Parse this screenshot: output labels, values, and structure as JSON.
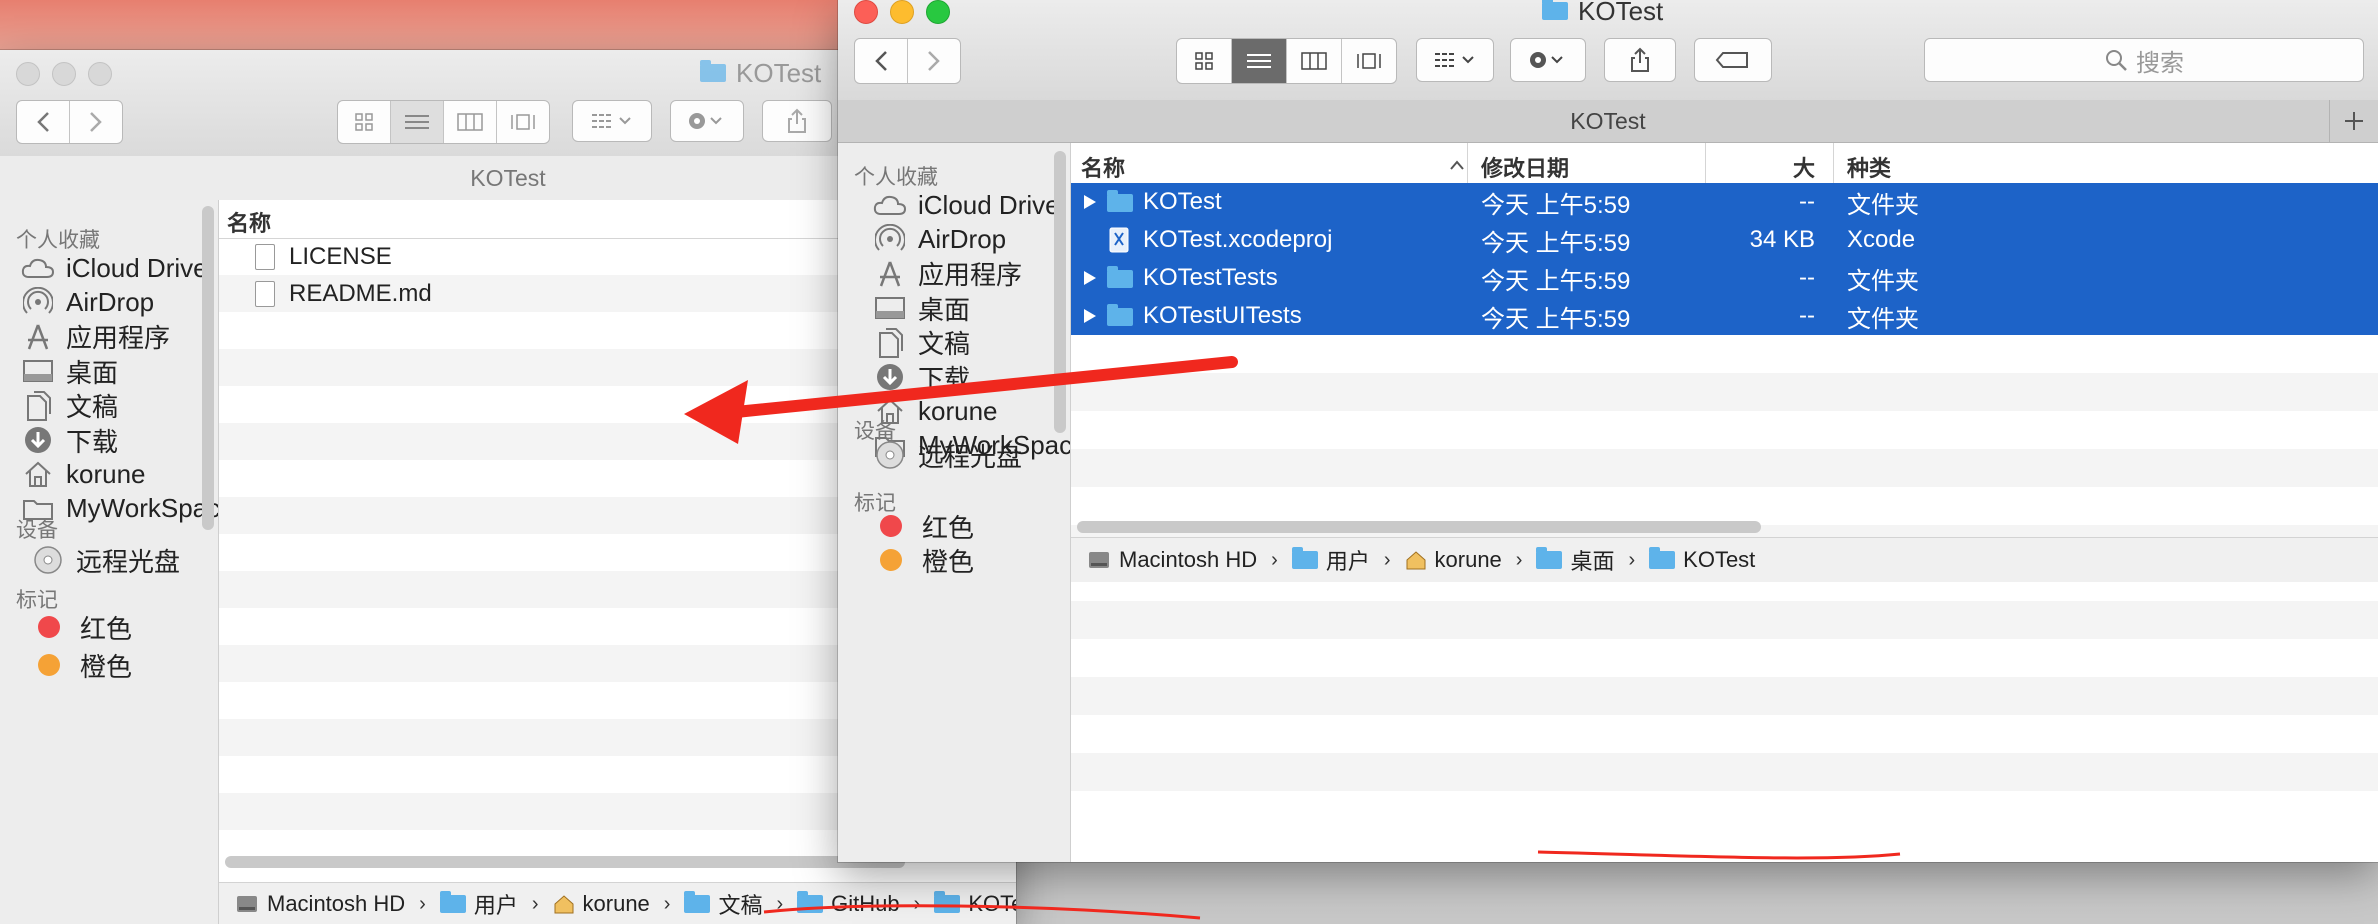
{
  "back_window": {
    "title": "KOTest",
    "tab_title": "KOTest",
    "sidebar": {
      "favorites_header": "个人收藏",
      "favorites": [
        {
          "label": "iCloud Drive",
          "icon": "cloud-icon"
        },
        {
          "label": "AirDrop",
          "icon": "airdrop-icon"
        },
        {
          "label": "应用程序",
          "icon": "applications-icon"
        },
        {
          "label": "桌面",
          "icon": "desktop-icon"
        },
        {
          "label": "文稿",
          "icon": "documents-icon"
        },
        {
          "label": "下载",
          "icon": "downloads-icon"
        },
        {
          "label": "korune",
          "icon": "home-icon"
        },
        {
          "label": "MyWorkSpaces",
          "icon": "folder-icon"
        }
      ],
      "devices_header": "设备",
      "devices": [
        {
          "label": "远程光盘",
          "icon": "disc-icon"
        }
      ],
      "tags_header": "标记",
      "tags": [
        {
          "label": "红色",
          "color": "#f0484b"
        },
        {
          "label": "橙色",
          "color": "#f5a236"
        }
      ]
    },
    "column_name": "名称",
    "files": [
      {
        "name": "LICENSE",
        "icon": "document-icon"
      },
      {
        "name": "README.md",
        "icon": "document-icon"
      }
    ],
    "path": [
      "Macintosh HD",
      "用户",
      "korune",
      "文稿",
      "GitHub",
      "KOTest"
    ]
  },
  "front_window": {
    "title": "KOTest",
    "tab_title": "KOTest",
    "search_placeholder": "搜索",
    "sidebar": {
      "favorites_header": "个人收藏",
      "favorites": [
        {
          "label": "iCloud Drive",
          "icon": "cloud-icon"
        },
        {
          "label": "AirDrop",
          "icon": "airdrop-icon"
        },
        {
          "label": "应用程序",
          "icon": "applications-icon"
        },
        {
          "label": "桌面",
          "icon": "desktop-icon"
        },
        {
          "label": "文稿",
          "icon": "documents-icon"
        },
        {
          "label": "下载",
          "icon": "downloads-icon"
        },
        {
          "label": "korune",
          "icon": "home-icon"
        },
        {
          "label": "MyWorkSpaces",
          "icon": "folder-icon"
        }
      ],
      "devices_header": "设备",
      "devices": [
        {
          "label": "远程光盘",
          "icon": "disc-icon"
        }
      ],
      "tags_header": "标记",
      "tags": [
        {
          "label": "红色",
          "color": "#f0484b"
        },
        {
          "label": "橙色",
          "color": "#f5a236"
        }
      ]
    },
    "columns": {
      "name": "名称",
      "date": "修改日期",
      "size": "大小",
      "kind": "种类"
    },
    "files": [
      {
        "name": "KOTest",
        "date": "今天 上午5:59",
        "size": "--",
        "kind": "文件夹",
        "folder": true
      },
      {
        "name": "KOTest.xcodeproj",
        "date": "今天 上午5:59",
        "size": "34 KB",
        "kind": "Xcode",
        "folder": false
      },
      {
        "name": "KOTestTests",
        "date": "今天 上午5:59",
        "size": "--",
        "kind": "文件夹",
        "folder": true
      },
      {
        "name": "KOTestUITests",
        "date": "今天 上午5:59",
        "size": "--",
        "kind": "文件夹",
        "folder": true
      }
    ],
    "path": [
      "Macintosh HD",
      "用户",
      "korune",
      "桌面",
      "KOTest"
    ]
  },
  "colors": {
    "selection": "#1d63c8",
    "annotation_red": "#f0281e",
    "folder_blue": "#5eb3ea"
  }
}
